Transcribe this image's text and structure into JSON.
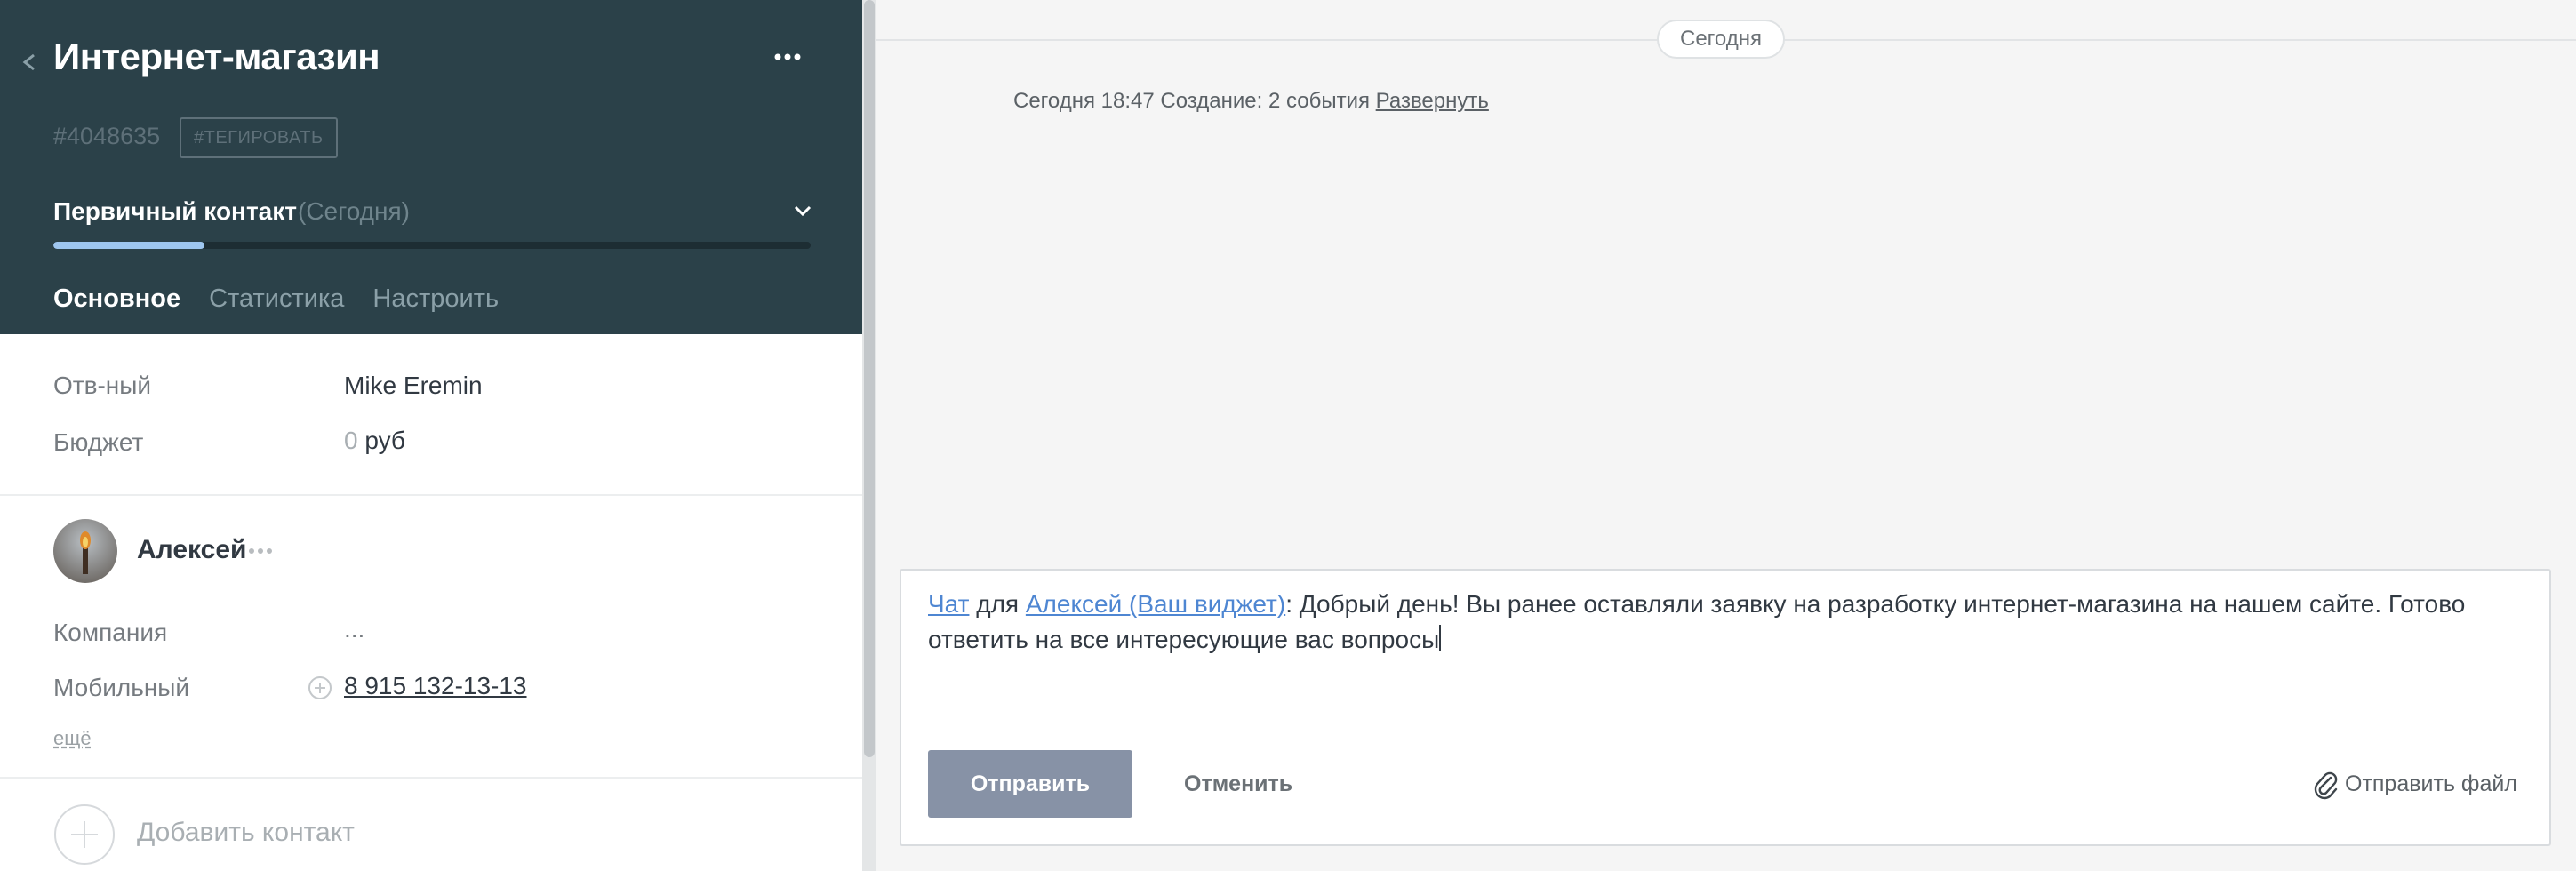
{
  "lead": {
    "title": "Интернет-магазин",
    "id": "#4048635",
    "tag_button": "#ТЕГИРОВАТЬ",
    "stage": {
      "name": "Первичный контакт",
      "date": "(Сегодня)",
      "progress": 0.2
    },
    "tabs": [
      {
        "label": "Основное",
        "active": true
      },
      {
        "label": "Статистика",
        "active": false
      },
      {
        "label": "Настроить",
        "active": false
      }
    ],
    "fields": {
      "responsible_label": "Отв-ный",
      "responsible_value": "Mike Eremin",
      "budget_label": "Бюджет",
      "budget_amount": "0",
      "budget_currency": "руб"
    }
  },
  "contact": {
    "name": "Алексей",
    "company_label": "Компания",
    "company_value": "...",
    "mobile_label": "Мобильный",
    "mobile_value": "8 915 132-13-13",
    "more_link": "ещё",
    "add_contact": "Добавить контакт"
  },
  "feed": {
    "day_label": "Сегодня",
    "event": {
      "text": "Сегодня 18:47 Создание: 2 события",
      "expand": "Развернуть"
    },
    "composer": {
      "chat_link": "Чат",
      "for_word": "для",
      "recipient_link": "Алексей (Ваш виджет)",
      "message": ": Добрый день! Вы ранее оставляли заявку на разработку интернет-магазина на нашем сайте. Готово ответить на все интересующие вас вопросы",
      "send": "Отправить",
      "cancel": "Отменить",
      "attach": "Отправить файл"
    }
  },
  "icons": {
    "back": "chevron-left-icon",
    "menu": "more-dots-icon",
    "stage_toggle": "chevron-down-icon",
    "add_phone": "plus-circle-icon",
    "add_contact": "plus-circle-icon",
    "attach": "paperclip-icon"
  },
  "colors": {
    "header_bg": "#2b4149",
    "progress_fill": "#9ec6ef",
    "link": "#4e86d2",
    "send_button": "#8792a6"
  }
}
